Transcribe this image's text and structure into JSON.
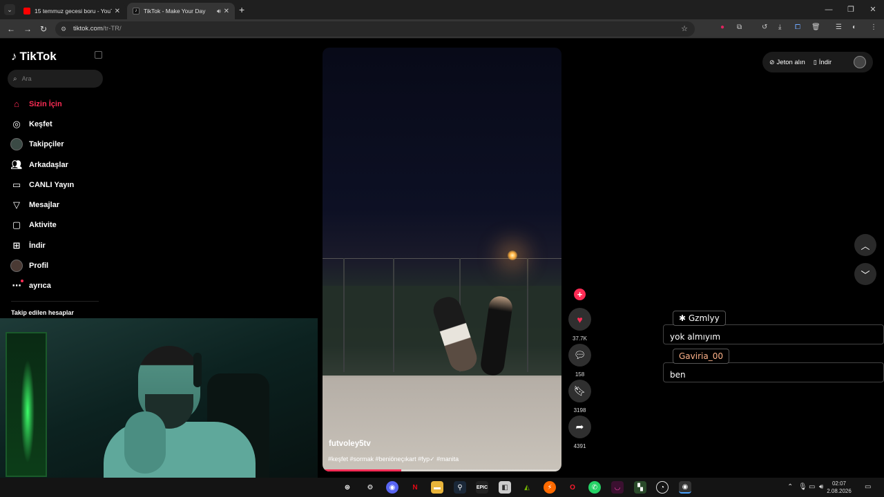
{
  "browser": {
    "tabs": [
      {
        "title": "15 temmuz gecesi boru - YouTu",
        "favicon": "youtube-icon",
        "active": false
      },
      {
        "title": "TikTok - Make Your Day",
        "favicon": "tiktok-icon",
        "active": true
      }
    ],
    "url_host": "tiktok.com",
    "url_path": "/tr-TR/"
  },
  "sidebar": {
    "logo": "TikTok",
    "search_placeholder": "Ara",
    "items": [
      {
        "label": "Sizin İçin",
        "icon": "home-icon",
        "active": true
      },
      {
        "label": "Keşfet",
        "icon": "compass-icon"
      },
      {
        "label": "Takipçiler",
        "icon": "avatar-icon"
      },
      {
        "label": "Arkadaşlar",
        "icon": "friends-icon"
      },
      {
        "label": "CANLI Yayın",
        "icon": "live-icon"
      },
      {
        "label": "Mesajlar",
        "icon": "send-icon"
      },
      {
        "label": "Aktivite",
        "icon": "activity-icon"
      },
      {
        "label": "İndir",
        "icon": "download-icon"
      },
      {
        "label": "Profil",
        "icon": "profile-avatar-icon"
      },
      {
        "label": "ayrıca",
        "icon": "more-icon"
      }
    ],
    "following_title": "Takip edilen hesaplar"
  },
  "video": {
    "username": "futvoley5tv",
    "hashtags": "#keşfet #sormak #beniöneçıkart #fyp✓ #manita",
    "progress": 0.33,
    "likes": "37.7K",
    "comments": "158",
    "saves": "3198",
    "shares": "4391"
  },
  "header_actions": {
    "coins": "Jeton alın",
    "download": "İndir"
  },
  "chat": [
    {
      "name": "Gzmlyy",
      "message": "yok almıyım",
      "name_color": "#ffffff"
    },
    {
      "name": "Gaviria_00",
      "message": "ben",
      "name_color": "#ffb38a"
    }
  ],
  "taskbar": {
    "time": "02:07",
    "date": "2.08.2026"
  },
  "colors": {
    "accent": "#fe2c55"
  }
}
